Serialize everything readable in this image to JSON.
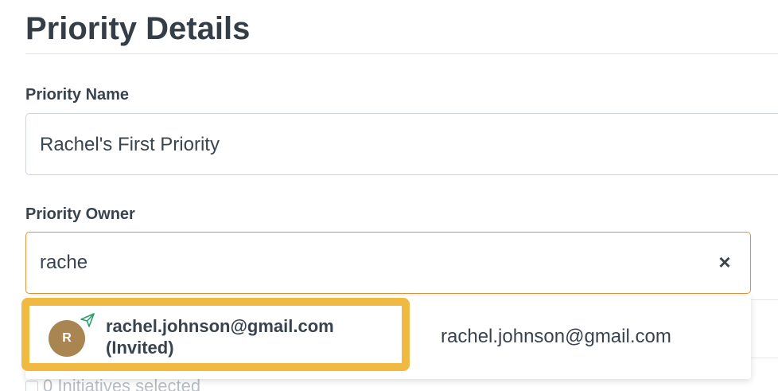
{
  "page": {
    "title": "Priority Details"
  },
  "priority_name": {
    "label": "Priority Name",
    "value": "Rachel's First Priority"
  },
  "priority_owner": {
    "label": "Priority Owner",
    "value": "rache",
    "clear_icon": "×"
  },
  "dropdown": {
    "options": [
      {
        "avatar_initial": "R",
        "avatar_color": "#a98551",
        "name_line1": "rachel.johnson@gmail.com",
        "name_line2": "(Invited)",
        "email": "rachel.johnson@gmail.com",
        "status_icon": "paper-plane-icon",
        "highlighted": true
      }
    ]
  },
  "background": {
    "initiatives_text": "0 Initiatives selected"
  },
  "colors": {
    "focus_border": "#e4903a",
    "highlight_border": "#f0b941",
    "invite_icon": "#2f9b6e"
  }
}
